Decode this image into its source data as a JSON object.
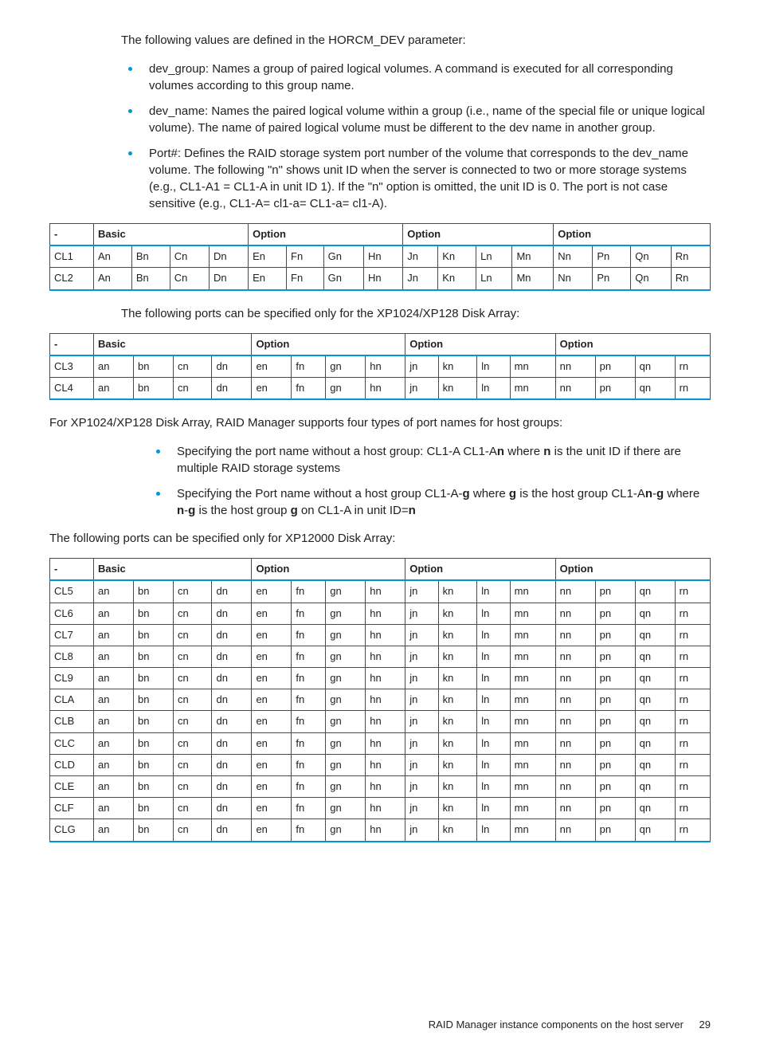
{
  "intro": "The following values are defined in the HORCM_DEV parameter:",
  "defs": [
    "dev_group: Names a group of paired logical volumes. A command is executed for all corresponding volumes according to this group name.",
    "dev_name: Names the paired logical volume within a group (i.e., name of the special file or unique logical volume). The name of paired logical volume must be different to the dev name in another group.",
    "Port#: Defines the RAID storage system port number of the volume that corresponds to the dev_name volume. The following \"n\" shows unit ID when the server is connected to two or more storage systems (e.g., CL1-A1 = CL1-A in unit ID 1). If the \"n\" option is omitted, the unit ID is 0. The port is not case sensitive (e.g., CL1-A= cl1-a= CL1-a= cl1-A)."
  ],
  "headerCols": [
    "-",
    "Basic",
    "Option",
    "Option",
    "Option"
  ],
  "table1": {
    "rows": [
      [
        "CL1",
        "An",
        "Bn",
        "Cn",
        "Dn",
        "En",
        "Fn",
        "Gn",
        "Hn",
        "Jn",
        "Kn",
        "Ln",
        "Mn",
        "Nn",
        "Pn",
        "Qn",
        "Rn"
      ],
      [
        "CL2",
        "An",
        "Bn",
        "Cn",
        "Dn",
        "En",
        "Fn",
        "Gn",
        "Hn",
        "Jn",
        "Kn",
        "Ln",
        "Mn",
        "Nn",
        "Pn",
        "Qn",
        "Rn"
      ]
    ]
  },
  "mid1": "The following ports can be specified only for the XP1024/XP128 Disk Array:",
  "table2": {
    "rows": [
      [
        "CL3",
        "an",
        "bn",
        "cn",
        "dn",
        "en",
        "fn",
        "gn",
        "hn",
        "jn",
        "kn",
        "ln",
        "mn",
        "nn",
        "pn",
        "qn",
        "rn"
      ],
      [
        "CL4",
        "an",
        "bn",
        "cn",
        "dn",
        "en",
        "fn",
        "gn",
        "hn",
        "jn",
        "kn",
        "ln",
        "mn",
        "nn",
        "pn",
        "qn",
        "rn"
      ]
    ]
  },
  "mid2": "For XP1024/XP128 Disk Array, RAID Manager supports four types of port names for host groups:",
  "sub": [
    "Specifying the port name without a host group: CL1-A CL1-A<b>n</b> where <b>n</b> is the unit ID if there are multiple RAID storage systems",
    "Specifying the Port name without a host group CL1-A-<b>g</b> where <b>g</b> is the host group CL1-A<b>n</b>-<b>g</b> where <b>n</b>-<b>g</b> is the host group <b>g</b> on CL1-A in unit ID=<b>n</b>"
  ],
  "mid3": "The following ports can be specified only for XP12000 Disk Array:",
  "table3": {
    "rows": [
      [
        "CL5",
        "an",
        "bn",
        "cn",
        "dn",
        "en",
        "fn",
        "gn",
        "hn",
        "jn",
        "kn",
        "ln",
        "mn",
        "nn",
        "pn",
        "qn",
        "rn"
      ],
      [
        "CL6",
        "an",
        "bn",
        "cn",
        "dn",
        "en",
        "fn",
        "gn",
        "hn",
        "jn",
        "kn",
        "ln",
        "mn",
        "nn",
        "pn",
        "qn",
        "rn"
      ],
      [
        "CL7",
        "an",
        "bn",
        "cn",
        "dn",
        "en",
        "fn",
        "gn",
        "hn",
        "jn",
        "kn",
        "ln",
        "mn",
        "nn",
        "pn",
        "qn",
        "rn"
      ],
      [
        "CL8",
        "an",
        "bn",
        "cn",
        "dn",
        "en",
        "fn",
        "gn",
        "hn",
        "jn",
        "kn",
        "ln",
        "mn",
        "nn",
        "pn",
        "qn",
        "rn"
      ],
      [
        "CL9",
        "an",
        "bn",
        "cn",
        "dn",
        "en",
        "fn",
        "gn",
        "hn",
        "jn",
        "kn",
        "ln",
        "mn",
        "nn",
        "pn",
        "qn",
        "rn"
      ],
      [
        "CLA",
        "an",
        "bn",
        "cn",
        "dn",
        "en",
        "fn",
        "gn",
        "hn",
        "jn",
        "kn",
        "ln",
        "mn",
        "nn",
        "pn",
        "qn",
        "rn"
      ],
      [
        "CLB",
        "an",
        "bn",
        "cn",
        "dn",
        "en",
        "fn",
        "gn",
        "hn",
        "jn",
        "kn",
        "ln",
        "mn",
        "nn",
        "pn",
        "qn",
        "rn"
      ],
      [
        "CLC",
        "an",
        "bn",
        "cn",
        "dn",
        "en",
        "fn",
        "gn",
        "hn",
        "jn",
        "kn",
        "ln",
        "mn",
        "nn",
        "pn",
        "qn",
        "rn"
      ],
      [
        "CLD",
        "an",
        "bn",
        "cn",
        "dn",
        "en",
        "fn",
        "gn",
        "hn",
        "jn",
        "kn",
        "ln",
        "mn",
        "nn",
        "pn",
        "qn",
        "rn"
      ],
      [
        "CLE",
        "an",
        "bn",
        "cn",
        "dn",
        "en",
        "fn",
        "gn",
        "hn",
        "jn",
        "kn",
        "ln",
        "mn",
        "nn",
        "pn",
        "qn",
        "rn"
      ],
      [
        "CLF",
        "an",
        "bn",
        "cn",
        "dn",
        "en",
        "fn",
        "gn",
        "hn",
        "jn",
        "kn",
        "ln",
        "mn",
        "nn",
        "pn",
        "qn",
        "rn"
      ],
      [
        "CLG",
        "an",
        "bn",
        "cn",
        "dn",
        "en",
        "fn",
        "gn",
        "hn",
        "jn",
        "kn",
        "ln",
        "mn",
        "nn",
        "pn",
        "qn",
        "rn"
      ]
    ]
  },
  "footer": {
    "title": "RAID Manager instance components on the host server",
    "page": "29"
  }
}
